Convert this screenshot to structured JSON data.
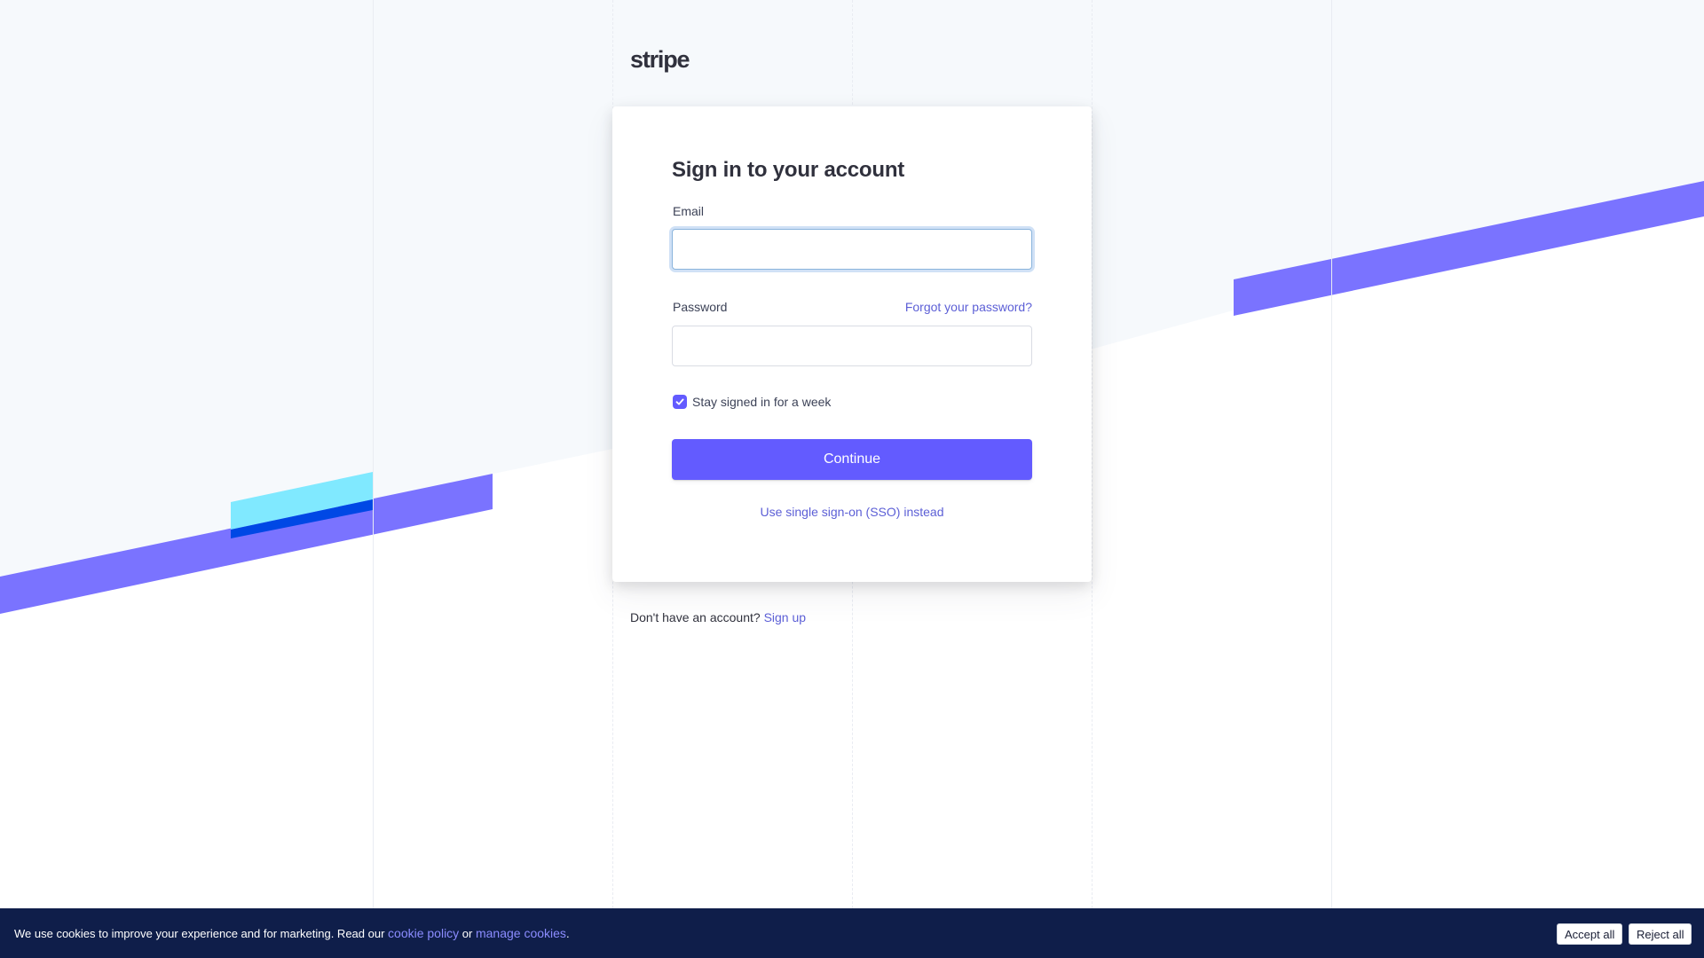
{
  "brand": {
    "logo_text": "stripe",
    "accent_color": "#635bff",
    "link_color": "#5c5fd6"
  },
  "form": {
    "title": "Sign in to your account",
    "email_label": "Email",
    "email_value": "",
    "password_label": "Password",
    "password_value": "",
    "forgot_password": "Forgot your password?",
    "stay_signed_in_label": "Stay signed in for a week",
    "stay_signed_in_checked": true,
    "continue_label": "Continue",
    "sso_label": "Use single sign-on (SSO) instead"
  },
  "signup": {
    "prompt": "Don't have an account?",
    "link": "Sign up"
  },
  "cookie_bar": {
    "text_before": "We use cookies to improve your experience and for marketing. Read our ",
    "cookie_policy": "cookie policy",
    "or_text": " or ",
    "manage_cookies": "manage cookies",
    "period": ".",
    "accept_all": "Accept all",
    "reject_all": "Reject all",
    "background_color": "#0f1e4a"
  },
  "icons": {
    "checkbox": "check-icon"
  }
}
